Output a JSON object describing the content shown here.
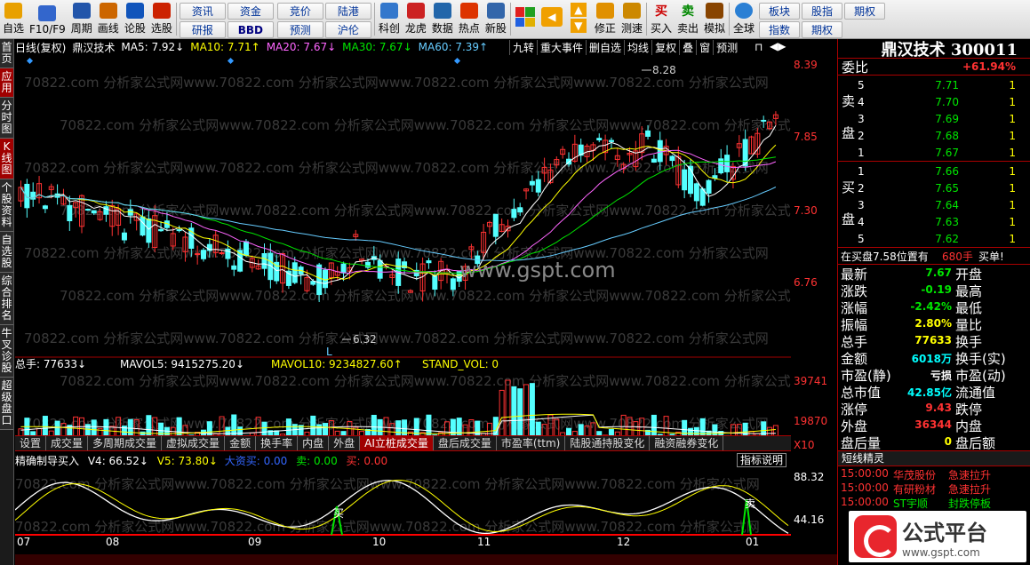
{
  "toolbar": {
    "buttons": [
      {
        "label": "自选",
        "icon": "star-icon",
        "color": "#e8a000"
      },
      {
        "label": "F10/F9",
        "icon": "document-icon",
        "color": "#3366cc"
      },
      {
        "label": "周期",
        "icon": "clock-icon",
        "color": "#2255aa"
      },
      {
        "label": "画线",
        "icon": "pencil-icon",
        "color": "#cc6600"
      },
      {
        "label": "论股",
        "icon": "discuss-icon",
        "color": "#1155bb"
      },
      {
        "label": "选股",
        "icon": "target-icon",
        "color": "#cc2200"
      }
    ],
    "grid1": [
      "资讯",
      "资金",
      "研报",
      "BBD"
    ],
    "grid2": [
      "竞价",
      "陆港",
      "预测",
      "沪伦"
    ],
    "buttons2": [
      {
        "label": "科创",
        "icon": "science-icon",
        "color": "#3377cc"
      },
      {
        "label": "龙虎",
        "icon": "dragon-icon",
        "color": "#cc2222"
      },
      {
        "label": "数据",
        "icon": "data-icon",
        "color": "#2266aa"
      },
      {
        "label": "热点",
        "icon": "hot-icon",
        "color": "#dd3300"
      },
      {
        "label": "新股",
        "icon": "new-stock-icon",
        "color": "#3366aa"
      }
    ],
    "buttons3": [
      {
        "label": "修正",
        "icon": "refresh-icon",
        "color": "#e09000"
      },
      {
        "label": "测速",
        "icon": "stopwatch-icon",
        "color": "#cc8800"
      }
    ],
    "trade": [
      {
        "label": "买入",
        "glyph": "买",
        "color": "#cc0000"
      },
      {
        "label": "卖出",
        "glyph": "卖",
        "color": "#008800"
      },
      {
        "label": "模拟",
        "icon": "hammer-icon",
        "color": "#884400"
      }
    ],
    "global_label": "全球",
    "grid3": [
      "板块",
      "股指",
      "期权",
      "指数",
      "期权"
    ]
  },
  "sidebar": [
    {
      "label": "首页",
      "active": false
    },
    {
      "label": "应用",
      "active": true
    },
    {
      "label": "分时图",
      "active": false
    },
    {
      "label": "K线图",
      "active": true
    },
    {
      "label": "个股资料",
      "active": false
    },
    {
      "label": "自选股",
      "active": false
    },
    {
      "label": "综合排名",
      "active": false
    },
    {
      "label": "牛叉诊股",
      "active": false
    },
    {
      "label": "超级盘口",
      "active": false
    }
  ],
  "kline": {
    "period": "日线(复权)",
    "stock": "鼎汉技术",
    "ma": [
      {
        "label": "MA5: 7.92↓",
        "color": "#ffffff"
      },
      {
        "label": "MA10: 7.71↑",
        "color": "#ffff00"
      },
      {
        "label": "MA20: 7.67↓",
        "color": "#ff66ff"
      },
      {
        "label": "MA30: 7.67↓",
        "color": "#00e600"
      },
      {
        "label": "MA60: 7.39↑",
        "color": "#66ccff"
      }
    ],
    "header_buttons": [
      "九转",
      "重大事件",
      "删自选",
      "均线",
      "复权",
      "叠",
      "窗",
      "预测"
    ],
    "price_axis": [
      "8.39",
      "7.85",
      "7.30",
      "6.76"
    ],
    "high_label": "8.28",
    "low_label": "6.32",
    "low_marker": "L",
    "watermark": "www.gspt.com"
  },
  "volume": {
    "labels": [
      {
        "text": "总手: 77633↓",
        "color": "#ffffff"
      },
      {
        "text": "MAVOL5: 9415275.20↓",
        "color": "#ffffff"
      },
      {
        "text": "MAVOL10: 9234827.60↑",
        "color": "#ffff00"
      },
      {
        "text": "STAND_VOL: 0",
        "color": "#ffff00"
      }
    ],
    "axis": [
      "39741",
      "19870",
      "X10"
    ]
  },
  "sub_tabs": [
    "设置",
    "成交量",
    "多周期成交量",
    "虚拟成交量",
    "金额",
    "换手率",
    "内盘",
    "外盘",
    "AI立桩成交量",
    "盘后成交量",
    "市盈率(ttm)",
    "陆股通持股变化",
    "融资融券变化"
  ],
  "sub_tab_active": 8,
  "indicator": {
    "name": "精确制导买入",
    "v4": "V4: 66.52↓",
    "v5": "V5: 73.80↓",
    "entry1": "大资买: 0.00",
    "entry2": "卖: 0.00",
    "entry3": "买: 0.00",
    "explain": "指标说明",
    "axis": [
      "88.32",
      "44.16"
    ],
    "buy_marker": "买",
    "sell_marker": "卖"
  },
  "months": [
    "07",
    "08",
    "09",
    "10",
    "11",
    "12",
    "01"
  ],
  "quote": {
    "title": "鼎汉技术 300011",
    "weibi_label": "委比",
    "weibi_value": "+61.94%",
    "sell_side": [
      "卖",
      "盘"
    ],
    "buy_side": [
      "买",
      "盘"
    ],
    "asks": [
      {
        "n": "5",
        "price": "7.71",
        "vol": "1"
      },
      {
        "n": "4",
        "price": "7.70",
        "vol": "1"
      },
      {
        "n": "3",
        "price": "7.69",
        "vol": "1"
      },
      {
        "n": "2",
        "price": "7.68",
        "vol": "1"
      },
      {
        "n": "1",
        "price": "7.67",
        "vol": "1"
      }
    ],
    "bids": [
      {
        "n": "1",
        "price": "7.66",
        "vol": "1"
      },
      {
        "n": "2",
        "price": "7.65",
        "vol": "1"
      },
      {
        "n": "3",
        "price": "7.64",
        "vol": "1"
      },
      {
        "n": "4",
        "price": "7.63",
        "vol": "1"
      },
      {
        "n": "5",
        "price": "7.62",
        "vol": "1"
      }
    ],
    "queue_prefix": "在买盘",
    "queue_price": "7.58",
    "queue_mid": "位置有",
    "queue_count": "680手",
    "queue_action": "买单!",
    "stats": [
      {
        "l1": "最新",
        "v1": "7.67",
        "c1": "#00e600",
        "l2": "开盘"
      },
      {
        "l1": "涨跌",
        "v1": "-0.19",
        "c1": "#00e600",
        "l2": "最高"
      },
      {
        "l1": "涨幅",
        "v1": "-2.42%",
        "c1": "#00e600",
        "l2": "最低"
      },
      {
        "l1": "振幅",
        "v1": "2.80%",
        "c1": "#ffff00",
        "l2": "量比"
      },
      {
        "l1": "总手",
        "v1": "77633",
        "c1": "#ffff00",
        "l2": "换手"
      },
      {
        "l1": "金额",
        "v1": "6018万",
        "c1": "#00ffff",
        "l2": "换手(实)"
      },
      {
        "l1": "市盈(静)",
        "v1": "亏损",
        "c1": "#ffffff",
        "l2": "市盈(动)"
      },
      {
        "l1": "总市值",
        "v1": "42.85亿",
        "c1": "#00ffff",
        "l2": "流通值"
      },
      {
        "l1": "涨停",
        "v1": "9.43",
        "c1": "#ff3232",
        "l2": "跌停"
      },
      {
        "l1": "外盘",
        "v1": "36344",
        "c1": "#ff3232",
        "l2": "内盘"
      },
      {
        "l1": "盘后量",
        "v1": "0",
        "c1": "#ffff00",
        "l2": "盘后额"
      }
    ],
    "wizard_title": "短线精灵",
    "wizard": [
      {
        "time": "15:00:00",
        "name": "华茂股份",
        "event": "急速拉升"
      },
      {
        "time": "15:00:00",
        "name": "有研粉材",
        "event": "急速拉升"
      },
      {
        "time": "15:00:00",
        "name": "ST宇顺",
        "event": "封跌停板"
      }
    ]
  },
  "logo": {
    "name": "公式平台",
    "url": "www.gspt.com"
  },
  "colors": {
    "up": "#ff3232",
    "down": "#54ffff",
    "bg": "#000000",
    "accent": "#a00000"
  }
}
